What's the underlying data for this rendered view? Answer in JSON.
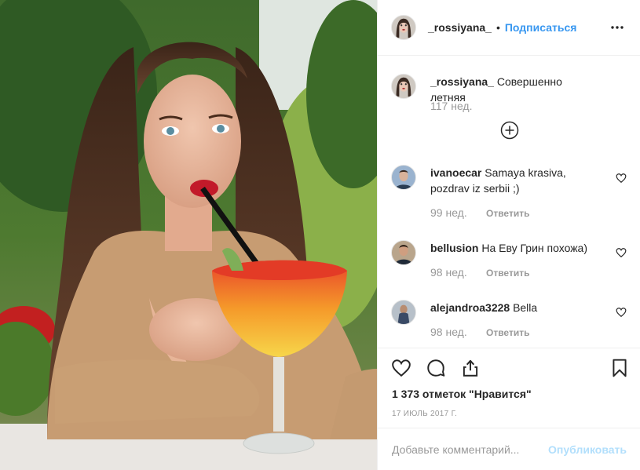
{
  "post": {
    "author": "_rossiyana_",
    "follow_label": "Подписаться",
    "separator": "•",
    "caption": {
      "username": "_rossiyana_",
      "text": "Совершенно летняя",
      "age": "117 нед."
    },
    "load_more_icon": "plus-circle-icon",
    "comments": [
      {
        "username": "ivanoecar",
        "text": "Samaya krasiva, pozdrav iz serbii ;)",
        "age": "99 нед.",
        "reply_label": "Ответить"
      },
      {
        "username": "bellusion",
        "text": "На Еву Грин похожа)",
        "age": "98 нед.",
        "reply_label": "Ответить"
      },
      {
        "username": "alejandroa3228",
        "text": "Bella",
        "age": "98 нед.",
        "reply_label": "Ответить"
      }
    ],
    "likes": "1 373 отметок \"Нравится\"",
    "date": "17 ИЮЛЬ 2017 Г.",
    "comment_placeholder": "Добавьте комментарий...",
    "publish_label": "Опубликовать"
  },
  "colors": {
    "link_blue": "#3897f0",
    "publish_disabled": "#b2dffc",
    "muted": "#999999",
    "text": "#262626"
  }
}
